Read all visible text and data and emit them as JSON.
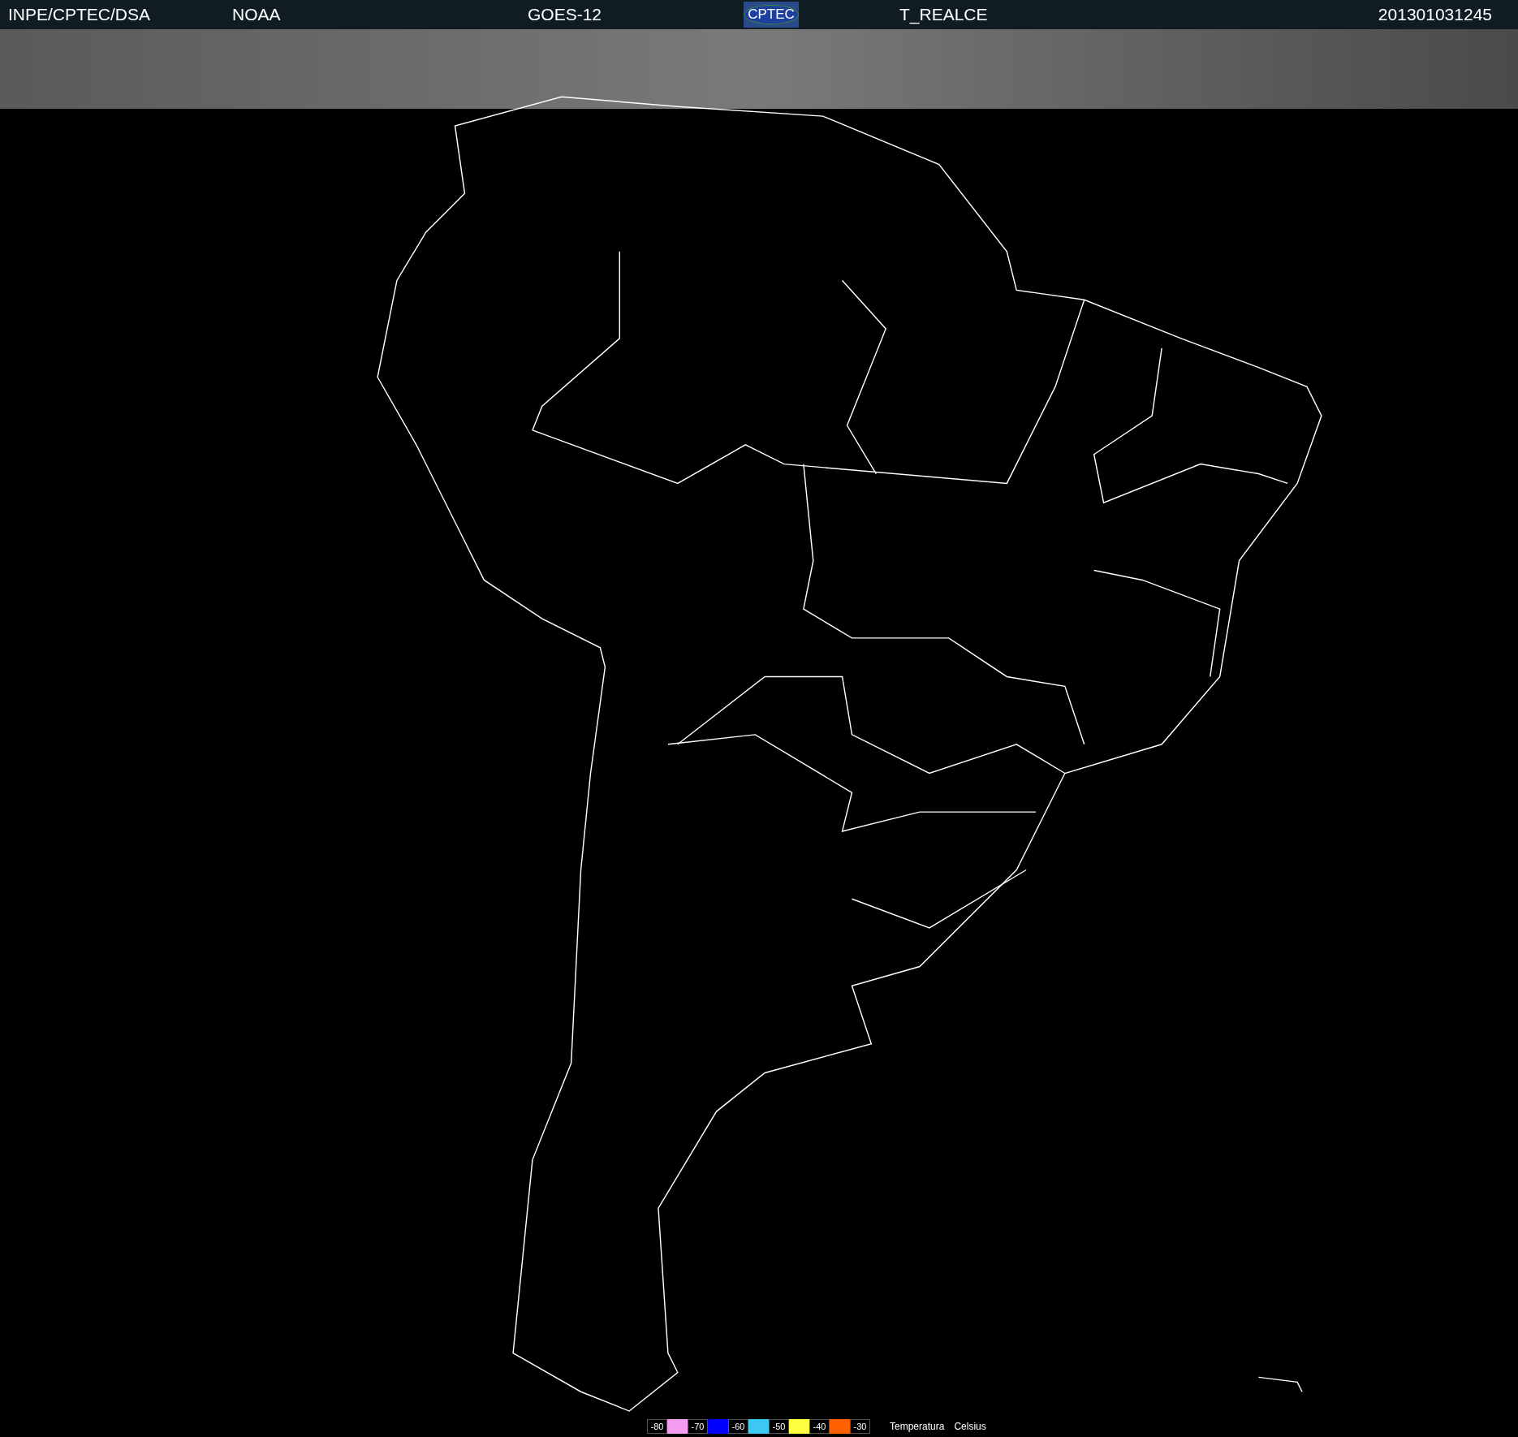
{
  "header": {
    "items": [
      {
        "kind": "text",
        "text": "INPE/CPTEC/DSA"
      },
      {
        "kind": "text",
        "text": "NOAA"
      },
      {
        "kind": "text",
        "text": "GOES-12"
      },
      {
        "kind": "logo",
        "text": "CPTEC"
      },
      {
        "kind": "text",
        "text": "T_REALCE"
      },
      {
        "kind": "text",
        "text": "201301031245"
      }
    ]
  },
  "legend": {
    "items": [
      {
        "kind": "label",
        "text": "-80"
      },
      {
        "kind": "swatch",
        "color": "#f49cf0"
      },
      {
        "kind": "label",
        "text": "-70"
      },
      {
        "kind": "swatch",
        "color": "#0000ff"
      },
      {
        "kind": "label",
        "text": "-60"
      },
      {
        "kind": "swatch",
        "color": "#3cc8f0"
      },
      {
        "kind": "label",
        "text": "-50"
      },
      {
        "kind": "swatch",
        "color": "#ffff40"
      },
      {
        "kind": "label",
        "text": "-40"
      },
      {
        "kind": "swatch",
        "color": "#ff6000"
      },
      {
        "kind": "label",
        "text": "-30"
      }
    ],
    "captions": [
      "Temperatura",
      "Celsius"
    ]
  }
}
